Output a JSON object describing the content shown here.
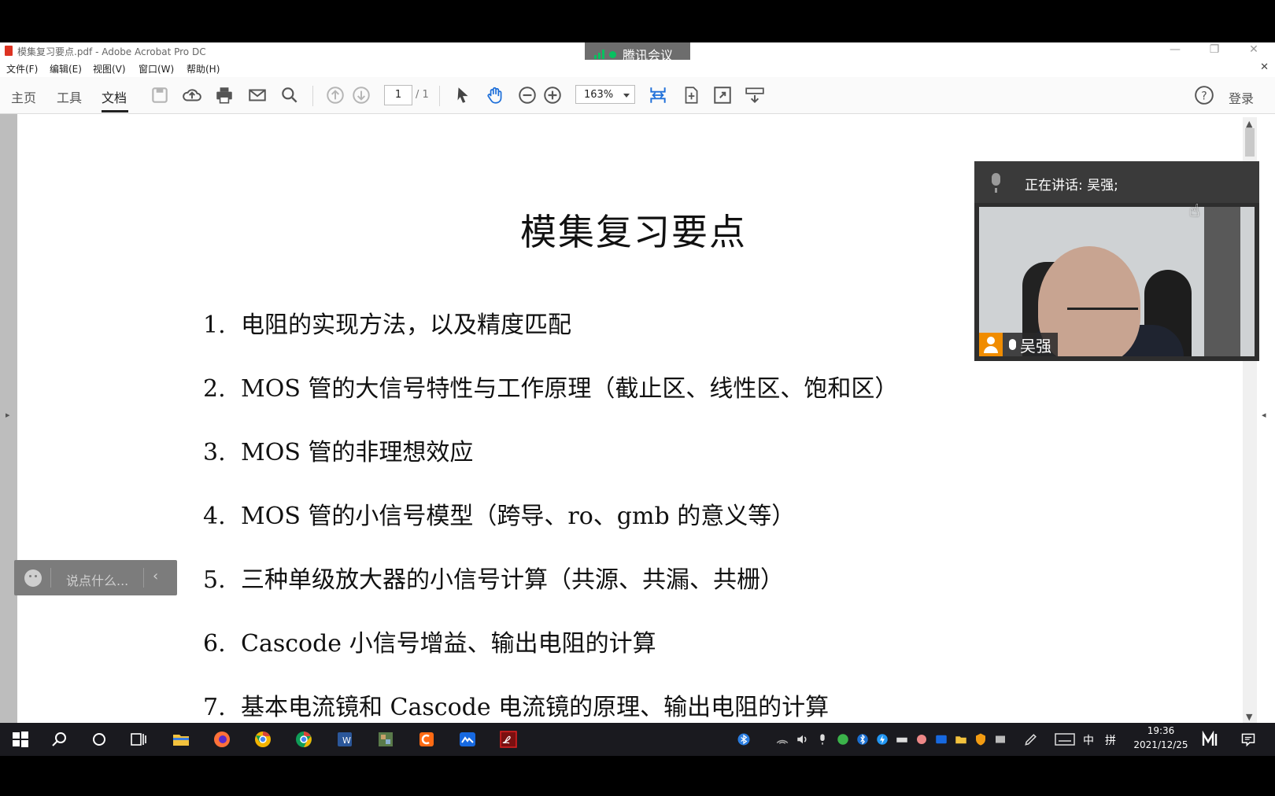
{
  "window": {
    "title": "模集复习要点.pdf - Adobe Acrobat Pro DC",
    "controls": {
      "minimize": "—",
      "restore": "❐",
      "close": "✕"
    }
  },
  "meeting": {
    "label": "腾讯会议"
  },
  "menu": {
    "items": [
      "文件(F)",
      "编辑(E)",
      "视图(V)",
      "窗口(W)",
      "帮助(H)"
    ],
    "close": "✕"
  },
  "toolbar": {
    "tabs": [
      "主页",
      "工具",
      "文档"
    ],
    "active_tab": "文档",
    "page_current": "1",
    "page_total": "/ 1",
    "zoom": "163%",
    "login": "登录"
  },
  "document": {
    "title": "模集复习要点",
    "items": [
      {
        "num": "1.",
        "text": "电阻的实现方法，以及精度匹配"
      },
      {
        "num": "2.",
        "text": "MOS 管的大信号特性与工作原理（截止区、线性区、饱和区）"
      },
      {
        "num": "3.",
        "text": "MOS 管的非理想效应"
      },
      {
        "num": "4.",
        "text": "MOS 管的小信号模型（跨导、ro、gmb 的意义等）"
      },
      {
        "num": "5.",
        "text": "三种单级放大器的小信号计算（共源、共漏、共栅）"
      },
      {
        "num": "6.",
        "text": "Cascode 小信号增益、输出电阻的计算"
      },
      {
        "num": "7.",
        "text": "基本电流镜和 Cascode 电流镜的原理、输出电阻的计算"
      }
    ]
  },
  "chat": {
    "placeholder": "说点什么...",
    "collapse": "‹"
  },
  "video": {
    "speaking": "正在讲话: 吴强;",
    "participant": "吴强"
  },
  "taskbar": {
    "ime": "中",
    "ime_mode": "拼",
    "time": "19:36",
    "date": "2021/12/25"
  },
  "colors": {
    "accent_green": "#07c160",
    "taskbar": "#1a1a1f",
    "acrobat_red": "#d32f2f"
  }
}
